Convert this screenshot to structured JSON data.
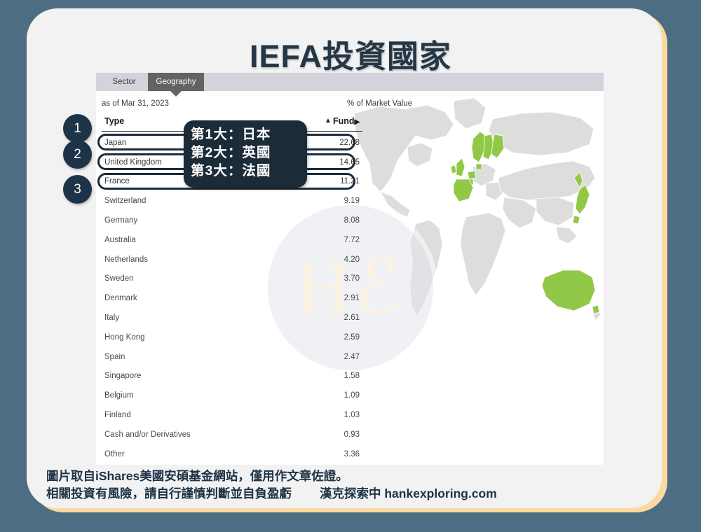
{
  "page": {
    "title": "IEFA投資國家",
    "bg_color": "#4d6d83",
    "card_color": "#f2f2f2",
    "accent_color": "#fbd9a0",
    "navy": "#1d3347"
  },
  "screenshot": {
    "tabs": [
      {
        "label": "Sector",
        "active": false
      },
      {
        "label": "Geography",
        "active": true
      }
    ],
    "as_of": "as of Mar 31, 2023",
    "value_unit_label": "% of Market Value",
    "columns": {
      "type": "Type",
      "sort_caret": "▲",
      "fund": "Fund",
      "fund_caret": "▶"
    },
    "rows": [
      {
        "name": "Japan",
        "value": "22.68"
      },
      {
        "name": "United Kingdom",
        "value": "14.65"
      },
      {
        "name": "France",
        "value": "11.21"
      },
      {
        "name": "Switzerland",
        "value": "9.19"
      },
      {
        "name": "Germany",
        "value": "8.08"
      },
      {
        "name": "Australia",
        "value": "7.72"
      },
      {
        "name": "Netherlands",
        "value": "4.20"
      },
      {
        "name": "Sweden",
        "value": "3.70"
      },
      {
        "name": "Denmark",
        "value": "2.91"
      },
      {
        "name": "Italy",
        "value": "2.61"
      },
      {
        "name": "Hong Kong",
        "value": "2.59"
      },
      {
        "name": "Spain",
        "value": "2.47"
      },
      {
        "name": "Singapore",
        "value": "1.58"
      },
      {
        "name": "Belgium",
        "value": "1.09"
      },
      {
        "name": "Finland",
        "value": "1.03"
      },
      {
        "name": "Cash and/or Derivatives",
        "value": "0.93"
      },
      {
        "name": "Other",
        "value": "3.36"
      }
    ],
    "map": {
      "base_color": "#dcdcdc",
      "highlight_color": "#8cc63f",
      "highlighted_regions": [
        "Japan",
        "United Kingdom",
        "France",
        "Sweden",
        "Norway",
        "Finland",
        "Netherlands",
        "Belgium",
        "Denmark",
        "Australia"
      ]
    },
    "watermark": "Hℰ"
  },
  "annotations": {
    "badges": [
      "1",
      "2",
      "3"
    ],
    "callout_lines": [
      "第1大：日本",
      "第2大：英國",
      "第3大：法國"
    ]
  },
  "caption": {
    "line1": "圖片取自iShares美國安碩基金網站，僅用作文章佐證。",
    "line2": "相關投資有風險，請自行謹慎判斷並自負盈虧",
    "brand": "漢克探索中 hankexploring.com"
  }
}
